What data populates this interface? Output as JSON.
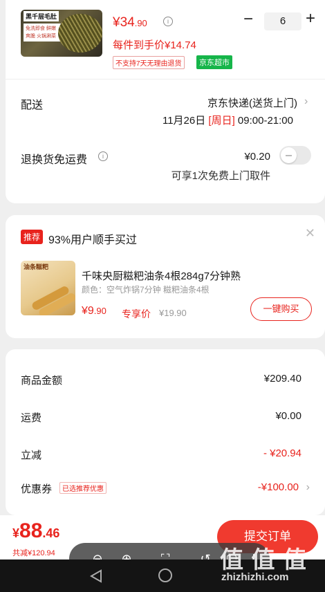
{
  "product": {
    "img_tag1": "黑千层毛肚",
    "img_tag2": "免洗即食 鲜嫩爽脆 火锅涮菜",
    "price_int": "¥34",
    "price_dec": ".90",
    "unit_price": "每件到手价¥14.74",
    "qty": "6",
    "badge_noreturn": "不支持7天无理由退货",
    "badge_store": "京东超市"
  },
  "delivery": {
    "label": "配送",
    "value": "京东快递(送货上门)",
    "date": "11月26日",
    "weekday": "[周日]",
    "time": "09:00-21:00"
  },
  "return_fee": {
    "label": "退换货免运费",
    "value": "¥0.20",
    "note": "可享1次免费上门取件"
  },
  "recommend": {
    "badge": "推荐",
    "title": "93%用户顺手买过",
    "img_text": "油条糍粑",
    "name": "千味央厨糍粑油条4根284g7分钟熟",
    "spec": "颜色：空气炸锅7分钟 糍粑油条4根",
    "price_int": "¥9",
    "price_dec": ".90",
    "tag": "专享价",
    "orig_price": "¥19.90",
    "buy": "一键购买"
  },
  "summary": {
    "rows": [
      {
        "label": "商品金额",
        "value": "¥209.40"
      },
      {
        "label": "运费",
        "value": "¥0.00"
      },
      {
        "label": "立减",
        "value": "- ¥20.94"
      },
      {
        "label": "优惠券",
        "value": "-¥100.00",
        "tag": "已选推荐优惠"
      }
    ]
  },
  "footer": {
    "cur": "¥",
    "int": "88",
    "dec": ".46",
    "save": "共减¥120.94",
    "submit": "提交订单"
  },
  "toolbar": {
    "icons": [
      "zoom-out-icon",
      "zoom-in-icon",
      "fit-screen-icon",
      "rotate-icon",
      "edit-icon",
      "more-icon"
    ]
  },
  "watermark": {
    "main": "值 值 值",
    "sub": "zhizhizhi.com"
  },
  "colors": {
    "accent": "#e8231d",
    "store_green": "#16b54a"
  }
}
